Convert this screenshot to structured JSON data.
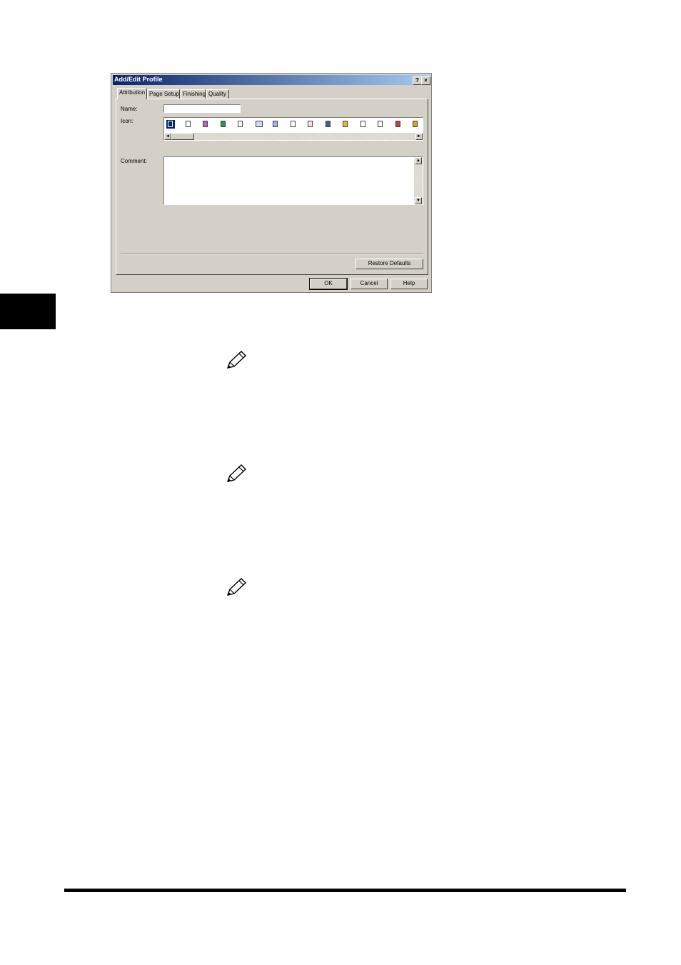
{
  "dialog": {
    "title": "Add/Edit Profile",
    "help_glyph": "?",
    "close_glyph": "×",
    "tabs": [
      {
        "label": "Attribution",
        "active": true
      },
      {
        "label": "Page Setup",
        "active": false
      },
      {
        "label": "Finishing",
        "active": false
      },
      {
        "label": "Quality",
        "active": false
      }
    ],
    "name_label": "Name:",
    "name_value": "",
    "icon_label": "Icon:",
    "icon_names": [
      "grid-doc-icon",
      "text-doc-icon",
      "layout-doc-icon",
      "image-doc-icon",
      "list-doc-icon",
      "table-doc-icon",
      "chart-doc-icon",
      "signature-doc-icon",
      "memo-doc-icon",
      "photo-doc-icon",
      "color-doc-icon",
      "form-doc-icon",
      "report-doc-icon",
      "gear-doc-icon",
      "person-doc-icon"
    ],
    "selected_icon": 0,
    "comment_label": "Comment:",
    "comment_value": "",
    "restore_defaults_label": "Restore Defaults",
    "ok_label": "OK",
    "cancel_label": "Cancel",
    "help_label": "Help",
    "scroll_left_glyph": "◄",
    "scroll_right_glyph": "►",
    "scroll_up_glyph": "▲",
    "scroll_down_glyph": "▼"
  },
  "page": {
    "note_icons": [
      "pencil-note-icon",
      "pencil-note-icon",
      "pencil-note-icon"
    ]
  }
}
